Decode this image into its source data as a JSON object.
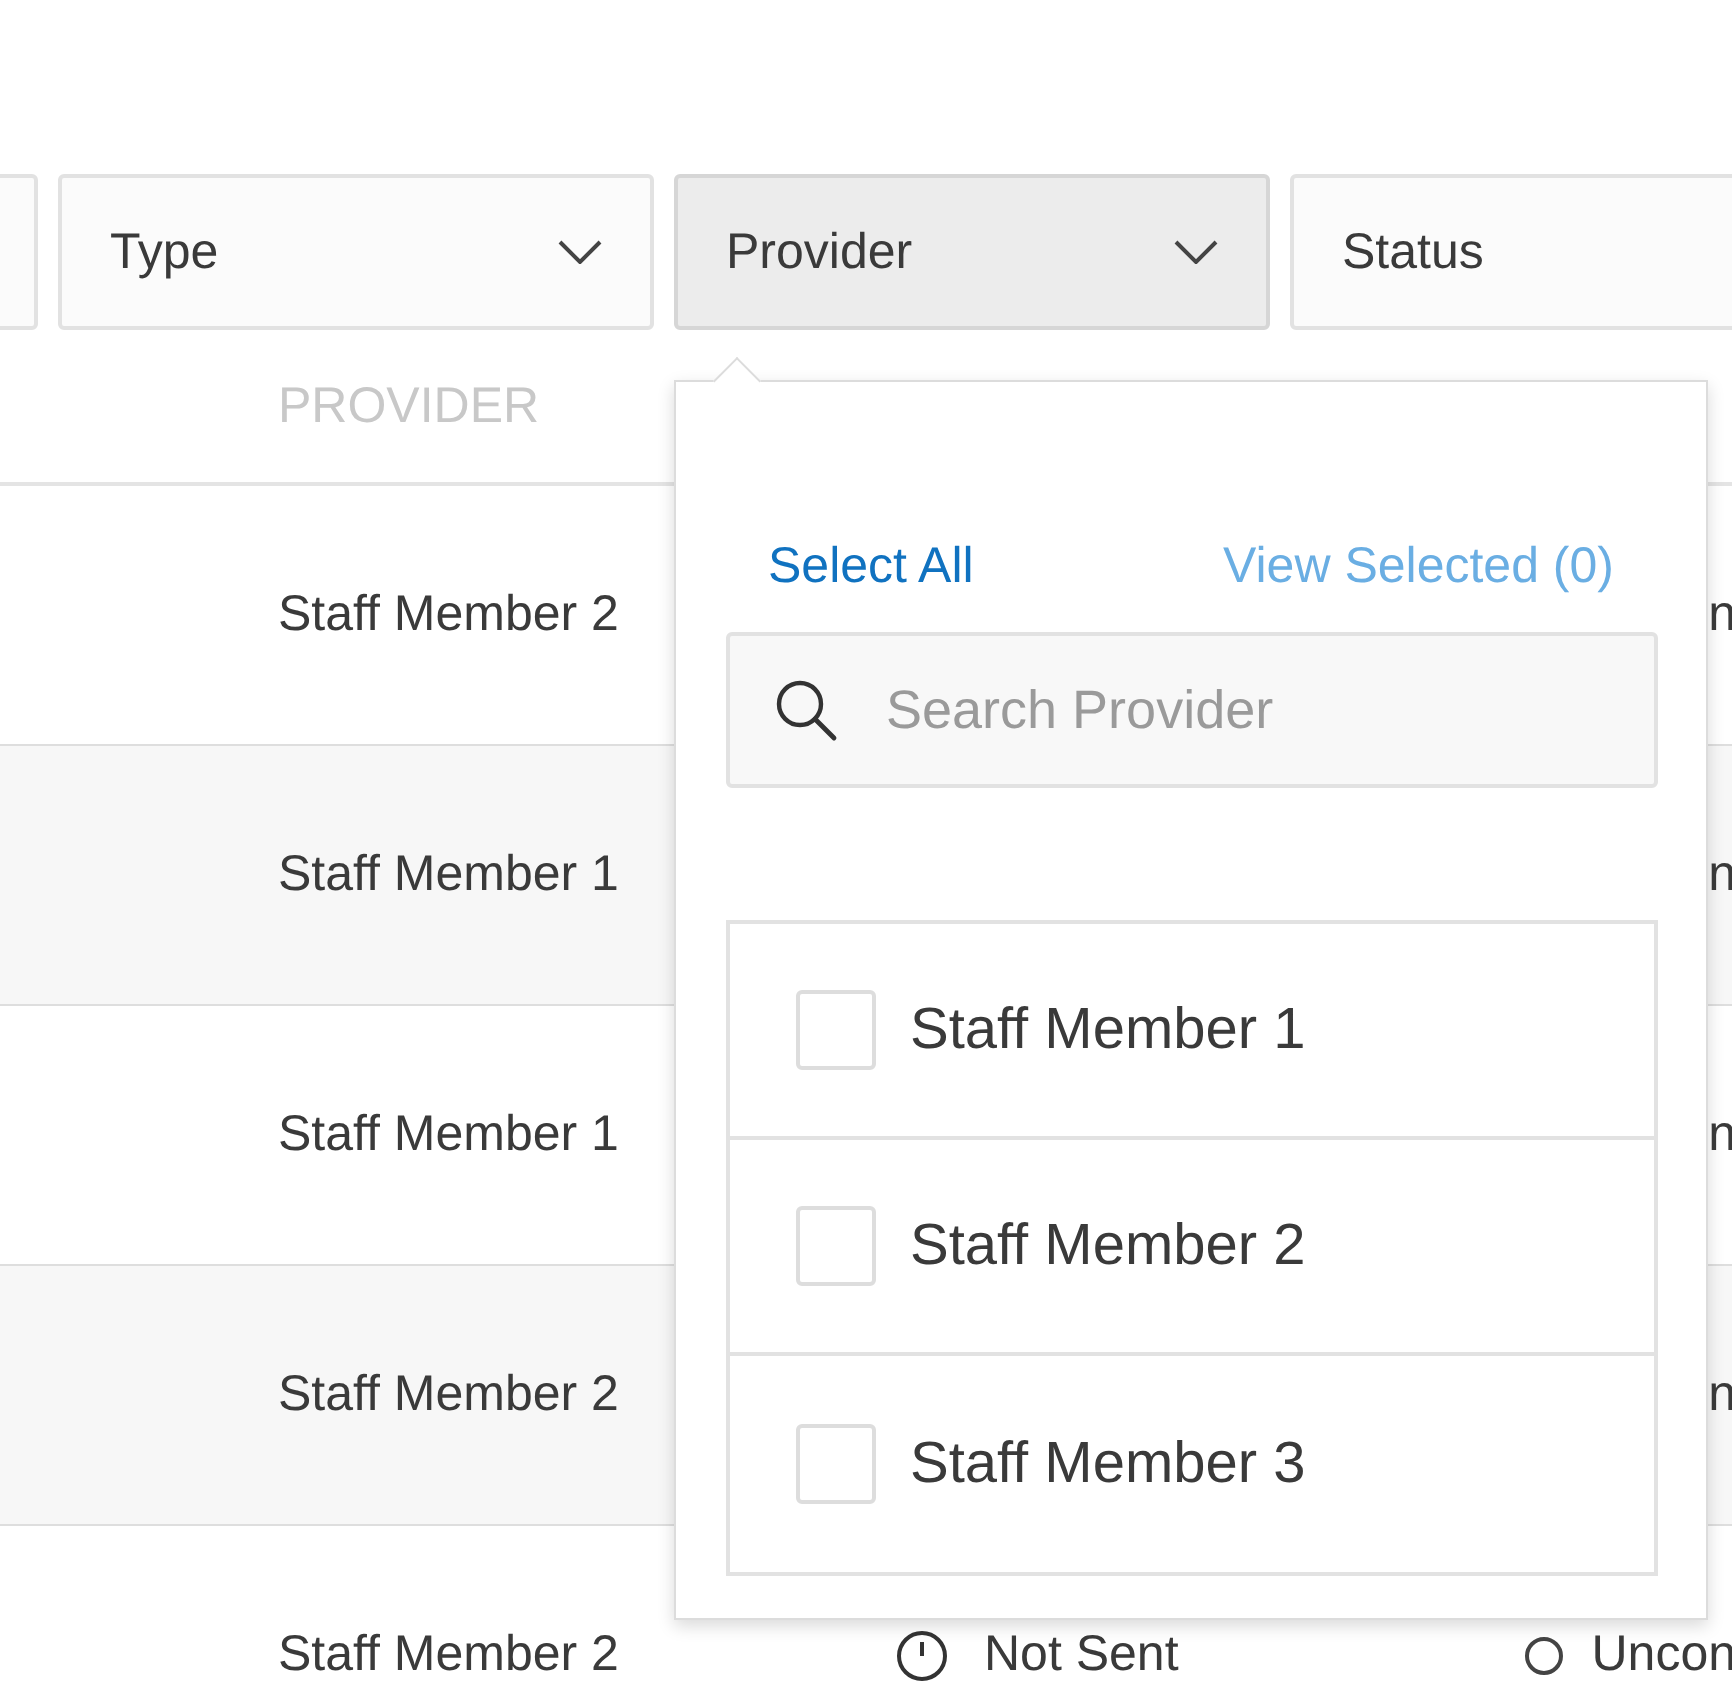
{
  "filters": [
    {
      "selected": false
    },
    {
      "label": "Type",
      "selected": false
    },
    {
      "label": "Provider",
      "selected": true
    },
    {
      "label": "Status",
      "selected": false
    }
  ],
  "table": {
    "columns": [
      "PROVIDER"
    ],
    "rows": [
      {
        "provider": "Staff Member 2",
        "status": {
          "kind": "partial",
          "text": "n"
        }
      },
      {
        "provider": "Staff Member 1",
        "status": {
          "kind": "partial",
          "text": "n"
        }
      },
      {
        "provider": "Staff Member 1",
        "status": {
          "kind": "partial",
          "text": "n"
        }
      },
      {
        "provider": "Staff Member 2",
        "status": {
          "kind": "partial",
          "text": "n"
        }
      },
      {
        "provider": "Staff Member 2",
        "sent": "Not Sent",
        "status": {
          "kind": "unconfirmed",
          "text": "Uncon"
        }
      }
    ]
  },
  "provider_dropdown": {
    "select_all": "Select All",
    "view_selected": "View Selected (0)",
    "search": {
      "placeholder": "Search Provider"
    },
    "items": [
      {
        "label": "Staff Member 1",
        "checked": false
      },
      {
        "label": "Staff Member 2",
        "checked": false
      },
      {
        "label": "Staff Member 3",
        "checked": false
      }
    ]
  }
}
